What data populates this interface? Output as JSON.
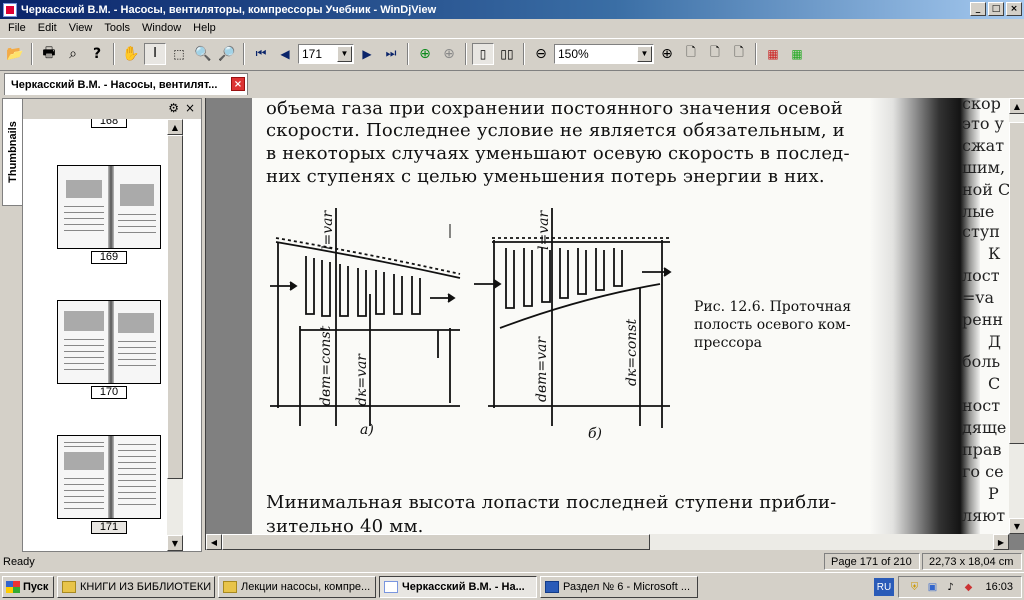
{
  "window": {
    "title": "Черкасский В.М. - Насосы, вентиляторы, компрессоры Учебник - WinDjView",
    "buttons": {
      "minimize": "_",
      "maximize": "□",
      "close": "×"
    }
  },
  "menu": [
    "File",
    "Edit",
    "View",
    "Tools",
    "Window",
    "Help"
  ],
  "toolbar": {
    "page_number": "171",
    "zoom": "150%"
  },
  "tab": {
    "label": "Черкасский В.М. - Насосы, вентилят..."
  },
  "thumbnails": {
    "tab_label": "Thumbnails",
    "pages": [
      {
        "label": "168"
      },
      {
        "label": "169"
      },
      {
        "label": "170"
      },
      {
        "label": "171"
      }
    ]
  },
  "document": {
    "lines": [
      "объема газа при сохранении постоянного значения осевой",
      "скорости. Последнее условие не является обязательным, и",
      "в некоторых случаях уменьшают осевую скорость в послед-",
      "них ступенях с целью уменьшения потерь энергии в них."
    ],
    "figure": {
      "caption": [
        "Рис. 12.6. Проточная",
        "полость осевого ком-",
        "прессора"
      ],
      "labels_a": {
        "l": "l=var",
        "dvt": "dвт=const",
        "dk": "dк=var",
        "sub": "а)"
      },
      "labels_b": {
        "l": "l=var",
        "dvt": "dвт=var",
        "dk": "dк=const",
        "sub": "б)"
      }
    },
    "bottom_lines": [
      "Минимальная высота лопасти последней ступени прибли-",
      "зительно 40 мм."
    ],
    "right_column": [
      "скор",
      "это у",
      "сжат",
      "шим,",
      "ной С",
      "лые",
      "ступ",
      "К",
      "лост",
      "=va",
      "ренн",
      "Д",
      "боль",
      "С",
      "ност",
      "дяще",
      "прав",
      "го се",
      "Р",
      "ляют"
    ]
  },
  "status": {
    "left": "Ready",
    "page": "Page 171 of 210",
    "size": "22,73 x 18,04 cm"
  },
  "taskbar": {
    "start": "Пуск",
    "tasks": [
      {
        "label": "КНИГИ ИЗ БИБЛИОТЕКИ"
      },
      {
        "label": "Лекции насосы, компре..."
      },
      {
        "label": "Черкасский В.М. - На..."
      },
      {
        "label": "Раздел № 6 - Microsoft ..."
      }
    ],
    "language": "RU",
    "clock": "16:03"
  }
}
